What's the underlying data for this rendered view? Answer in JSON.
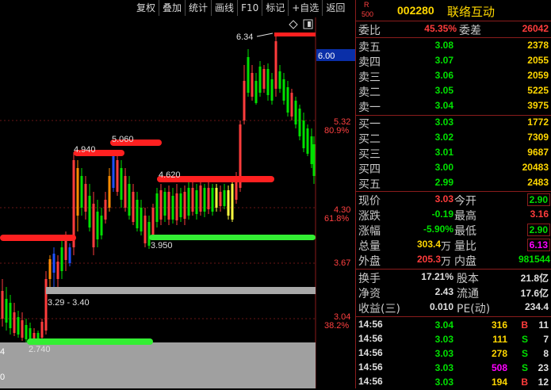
{
  "toolbar": {
    "buttons": [
      "复权",
      "叠加",
      "统计",
      "画线",
      "F10",
      "标记",
      "+自选",
      "返回"
    ]
  },
  "chart": {
    "price_labels": {
      "current_box": "6.00",
      "p532": "5.32",
      "pct809": "80.9%",
      "p430": "4.30",
      "pct618": "61.8%",
      "p367": "3.67",
      "p304": "3.04",
      "pct382": "38.2%"
    },
    "annotations": {
      "high": "6.34",
      "r4940": "4.940",
      "r5060": "5.060",
      "r4620": "4.620",
      "s3950": "3.950",
      "range": "3.29 - 3.40",
      "low": "2.740"
    },
    "volume_labels": {
      "v1": "4",
      "v2": "0"
    },
    "icons": {
      "diamond": "diamond-icon",
      "window": "restore-window-icon"
    }
  },
  "stock": {
    "market_letter": "R",
    "market_num": "500",
    "code": "002280",
    "name": "联络互动"
  },
  "commit": {
    "ratio_label": "委比",
    "ratio_value": "45.35%",
    "diff_label": "委差",
    "diff_value": "26042"
  },
  "sell": [
    {
      "label": "卖五",
      "price": "3.08",
      "vol": "2378"
    },
    {
      "label": "卖四",
      "price": "3.07",
      "vol": "2055"
    },
    {
      "label": "卖三",
      "price": "3.06",
      "vol": "2059"
    },
    {
      "label": "卖二",
      "price": "3.05",
      "vol": "5225"
    },
    {
      "label": "卖一",
      "price": "3.04",
      "vol": "3975"
    }
  ],
  "buy": [
    {
      "label": "买一",
      "price": "3.03",
      "vol": "1772"
    },
    {
      "label": "买二",
      "price": "3.02",
      "vol": "7309"
    },
    {
      "label": "买三",
      "price": "3.01",
      "vol": "9687"
    },
    {
      "label": "买四",
      "price": "3.00",
      "vol": "20483"
    },
    {
      "label": "买五",
      "price": "2.99",
      "vol": "2483"
    }
  ],
  "quote": {
    "now_label": "现价",
    "now": "3.03",
    "open_label": "今开",
    "open": "2.90",
    "chg_label": "涨跌",
    "chg": "-0.19",
    "high_label": "最高",
    "high": "3.16",
    "pct_label": "涨幅",
    "pct": "-5.90%",
    "low_label": "最低",
    "low": "2.90",
    "vol_label": "总量",
    "vol": "303.4",
    "vol_unit": "万",
    "vr_label": "量比",
    "vr": "6.13",
    "out_label": "外盘",
    "out": "205.3",
    "out_unit": "万",
    "in_label": "内盘",
    "in": "981544"
  },
  "fund": {
    "turn_label": "换手",
    "turn": "17.21%",
    "cap_label": "股本",
    "cap": "21.8亿",
    "na_label": "净资",
    "na": "2.43",
    "float_label": "流通",
    "float": "17.6亿",
    "eps_label": "收益(三)",
    "eps": "0.010",
    "pe_label": "PE(动)",
    "pe": "234.4"
  },
  "ticks": [
    {
      "time": "14:56",
      "price": "3.04",
      "vol": "316",
      "side": "B",
      "n": "11"
    },
    {
      "time": "14:56",
      "price": "3.03",
      "vol": "111",
      "side": "S",
      "n": "7"
    },
    {
      "time": "14:56",
      "price": "3.03",
      "vol": "278",
      "side": "S",
      "n": "8"
    },
    {
      "time": "14:56",
      "price": "3.03",
      "vol": "508",
      "side": "S",
      "n": "23"
    },
    {
      "time": "14:56",
      "price": "3.03",
      "vol": "194",
      "side": "B",
      "n": "12"
    }
  ],
  "colors": {
    "up": "#ff3c3c",
    "down": "#00e000",
    "grid": "#8a1c1c",
    "support": "#33ee33",
    "resist": "#ff2020"
  }
}
